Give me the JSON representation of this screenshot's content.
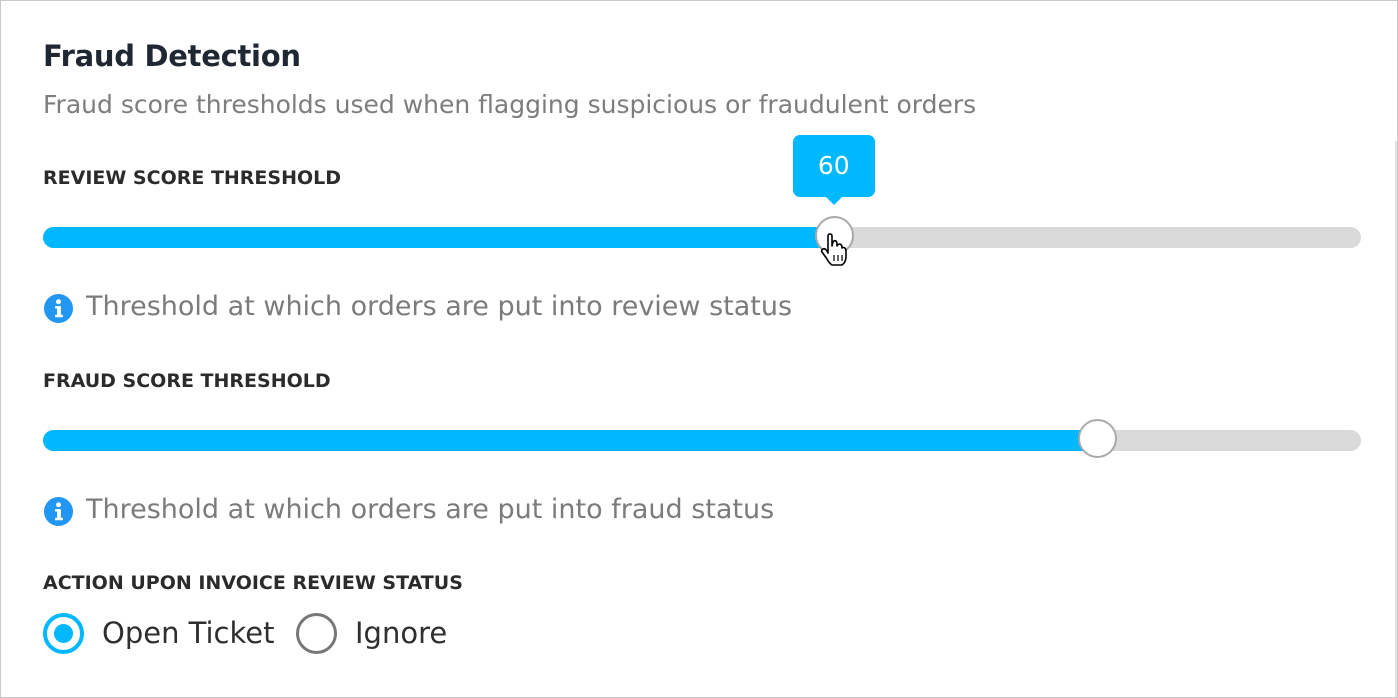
{
  "section": {
    "title": "Fraud Detection",
    "subtitle": "Fraud score thresholds used when flagging suspicious or fraudulent orders"
  },
  "review_threshold": {
    "label": "REVIEW SCORE THRESHOLD",
    "value": 60,
    "tooltip": "60",
    "help": "Threshold at which orders are put into review status"
  },
  "fraud_threshold": {
    "label": "FRAUD SCORE THRESHOLD",
    "value": 80,
    "help": "Threshold at which orders are put into fraud status"
  },
  "invoice_action": {
    "label": "ACTION UPON INVOICE REVIEW STATUS",
    "options": [
      {
        "label": "Open Ticket",
        "selected": true
      },
      {
        "label": "Ignore",
        "selected": false
      }
    ]
  },
  "icons": {
    "info": "info-icon",
    "cursor": "hand-cursor-icon"
  },
  "colors": {
    "accent": "#00b8ff",
    "info": "#2196f3",
    "track": "#dadada"
  }
}
